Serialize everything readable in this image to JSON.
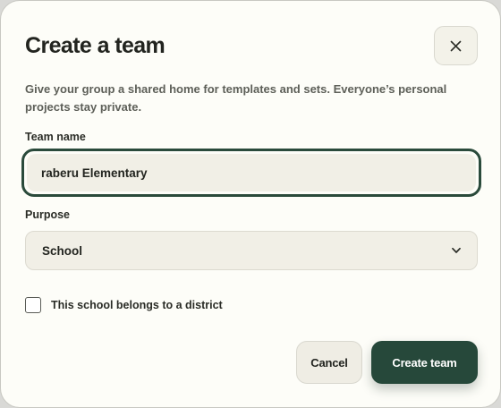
{
  "dialog": {
    "title": "Create a team",
    "description": "Give your group a shared home for templates and sets. Everyone’s personal projects stay private.",
    "close_icon": "close-icon"
  },
  "form": {
    "team_name_label": "Team name",
    "team_name_value": "raberu Elementary",
    "purpose_label": "Purpose",
    "purpose_value": "School",
    "district_checkbox_label": "This school belongs to a district",
    "district_checked": false
  },
  "actions": {
    "cancel_label": "Cancel",
    "create_label": "Create team"
  },
  "colors": {
    "accent": "#26483a",
    "background": "#fdfdf8",
    "field_bg": "#f1efe6"
  }
}
